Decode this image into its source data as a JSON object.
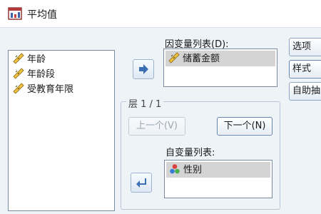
{
  "window": {
    "title": "平均值",
    "icon": "means-procedure-icon"
  },
  "source_variables": [
    {
      "label": "年龄",
      "icon": "scale-ruler-icon"
    },
    {
      "label": "年龄段",
      "icon": "scale-ruler-icon"
    },
    {
      "label": "受教育年限",
      "icon": "scale-ruler-icon"
    }
  ],
  "dependent": {
    "label": "因变量列表(D):",
    "items": [
      {
        "label": "储蓄金额",
        "icon": "scale-ruler-icon"
      }
    ]
  },
  "layer": {
    "label": "层 1 / 1",
    "prev_button": "上一个(V)",
    "next_button": "下一个(N)",
    "independent_label": "自变量列表:",
    "items": [
      {
        "label": "性别",
        "icon": "nominal-circles-icon"
      }
    ]
  },
  "side_buttons": [
    "选项",
    "样式",
    "自助抽"
  ],
  "colors": {
    "dialog_bg": "#eef3f8",
    "arrow": "#3b6fb4",
    "selection": "#d4d4d4"
  }
}
